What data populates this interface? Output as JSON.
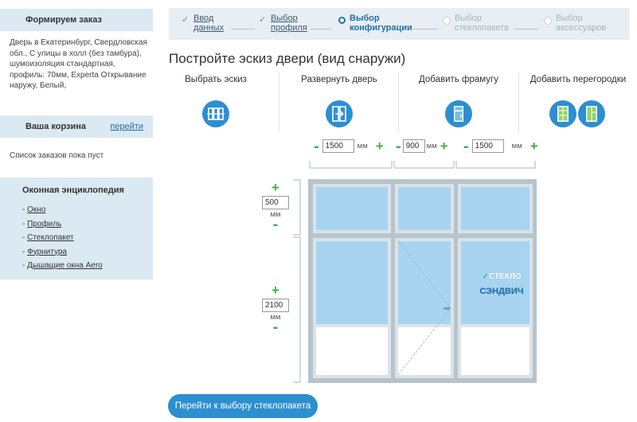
{
  "sidebar": {
    "order": {
      "title": "Формируем заказ",
      "description": "Дверь в Екатеринбург, Свердловская обл., С улицы в холл (без тамбура), шумоизоляция стандартная, профиль: 70мм, Experta Открывание наружу, Белый,"
    },
    "cart": {
      "title": "Ваша корзина",
      "link": "перейти",
      "empty_text": "Список заказов пока пуст"
    },
    "encyclopedia": {
      "title": "Оконная энциклопедия",
      "items": [
        "Окно",
        "Профиль",
        "Стеклопакет",
        "Фурнитура",
        "Дышащие окна Aero"
      ]
    }
  },
  "steps": [
    {
      "line1": "Ввод",
      "line2": "данных",
      "state": "done"
    },
    {
      "line1": "Выбор",
      "line2": "профиля",
      "state": "done"
    },
    {
      "line1": "Выбор",
      "line2": "конфигурации",
      "state": "active"
    },
    {
      "line1": "Выбор",
      "line2": "стеклопакета",
      "state": "todo"
    },
    {
      "line1": "Выбор",
      "line2": "аксессуаров",
      "state": "todo"
    }
  ],
  "main": {
    "title": "Постройте эскиз двери (вид снаружи)",
    "options": [
      {
        "label": "Выбрать эскиз",
        "icon": "sketch-icon"
      },
      {
        "label": "Развернуть дверь",
        "icon": "flip-door-icon"
      },
      {
        "label": "Добавить фрамугу",
        "icon": "transom-icon"
      },
      {
        "label": "Добавить перегородки",
        "icon": "partition-icon"
      }
    ],
    "widths": [
      {
        "value": "1500",
        "unit": "мм"
      },
      {
        "value": "900",
        "unit": "мм"
      },
      {
        "value": "1500",
        "unit": "мм"
      }
    ],
    "heights": [
      {
        "value": "500",
        "unit": "мм"
      },
      {
        "value": "2100",
        "unit": "мм"
      }
    ],
    "glass_badge": {
      "line1": "СТЕКЛО",
      "line2": "СЭНДВИЧ"
    },
    "cta": "Перейти к выбору стеклопакета"
  },
  "colors": {
    "accent": "#2d8fd0",
    "plus_minus": "#3cb050",
    "panel": "#dbe9f3",
    "glass": "#a8d4f2",
    "frame": "#b7c4cc"
  }
}
